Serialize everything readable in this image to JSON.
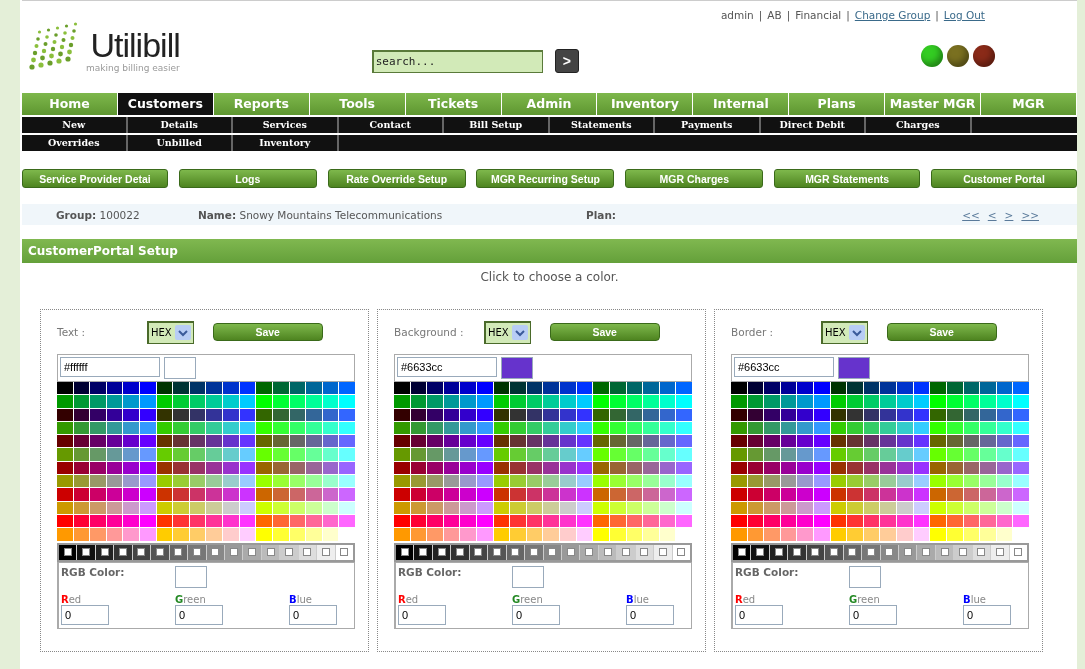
{
  "header": {
    "logo_name": "Utilibill",
    "logo_tagline": "making billing easier",
    "search": {
      "placeholder": "search..."
    },
    "search_button": ">",
    "user_links": [
      {
        "label": "admin",
        "kind": "text"
      },
      {
        "label": "AB",
        "kind": "text"
      },
      {
        "label": "Financial",
        "kind": "text"
      },
      {
        "label": "Change Group",
        "kind": "link"
      },
      {
        "label": "Log Out",
        "kind": "link"
      }
    ],
    "separator": "|",
    "status_lights": [
      {
        "color": "#33cc22"
      },
      {
        "color": "#7a7020"
      },
      {
        "color": "#8a2a18"
      }
    ]
  },
  "nav_tabs": [
    {
      "label": "Home",
      "selected": false
    },
    {
      "label": "Customers",
      "selected": true
    },
    {
      "label": "Reports",
      "selected": false
    },
    {
      "label": "Tools",
      "selected": false
    },
    {
      "label": "Tickets",
      "selected": false
    },
    {
      "label": "Admin",
      "selected": false
    },
    {
      "label": "Inventory",
      "selected": false
    },
    {
      "label": "Internal",
      "selected": false
    },
    {
      "label": "Plans",
      "selected": false
    },
    {
      "label": "Master MGR",
      "selected": false
    },
    {
      "label": "MGR",
      "selected": false
    }
  ],
  "sub_nav_rows": [
    [
      "New",
      "Details",
      "Services",
      "Contact",
      "Bill Setup",
      "Statements",
      "Payments",
      "Direct Debit",
      "Charges"
    ],
    [
      "Overrides",
      "Unbilled",
      "Inventory"
    ]
  ],
  "action_buttons": [
    "Service Provider Detai",
    "Logs",
    "Rate Override Setup",
    "MGR Recurring Setup",
    "MGR Charges",
    "MGR Statements",
    "Customer Portal"
  ],
  "customer_info": {
    "group_label": "Group:",
    "group_value": "100022",
    "name_label": "Name:",
    "name_value": "Snowy Mountains Telecommunications",
    "plan_label": "Plan:",
    "pager": [
      "<<",
      "<",
      ">",
      ">>"
    ]
  },
  "section_title": "CustomerPortal Setup",
  "instruction": "Click to choose a color.",
  "pickers": [
    {
      "label": "Text :",
      "format": "HEX",
      "save": "Save",
      "hex_value": "#ffffff",
      "rgb_label": "RGB Color:",
      "channels": [
        {
          "initial": "R",
          "rest": "ed",
          "color": "#ff0000",
          "value": "0"
        },
        {
          "initial": "G",
          "rest": "reen",
          "color": "#228822",
          "value": "0"
        },
        {
          "initial": "B",
          "rest": "lue",
          "color": "#0000ff",
          "value": "0"
        }
      ]
    },
    {
      "label": "Background :",
      "format": "HEX",
      "save": "Save",
      "hex_value": "#6633cc",
      "rgb_label": "RGB Color:",
      "channels": [
        {
          "initial": "R",
          "rest": "ed",
          "color": "#ff0000",
          "value": "0"
        },
        {
          "initial": "G",
          "rest": "reen",
          "color": "#228822",
          "value": "0"
        },
        {
          "initial": "B",
          "rest": "lue",
          "color": "#0000ff",
          "value": "0"
        }
      ]
    },
    {
      "label": "Border :",
      "format": "HEX",
      "save": "Save",
      "hex_value": "#6633cc",
      "rgb_label": "RGB Color:",
      "channels": [
        {
          "initial": "R",
          "rest": "ed",
          "color": "#ff0000",
          "value": "0"
        },
        {
          "initial": "G",
          "rest": "reen",
          "color": "#228822",
          "value": "0"
        },
        {
          "initial": "B",
          "rest": "lue",
          "color": "#0000ff",
          "value": "0"
        }
      ]
    }
  ]
}
